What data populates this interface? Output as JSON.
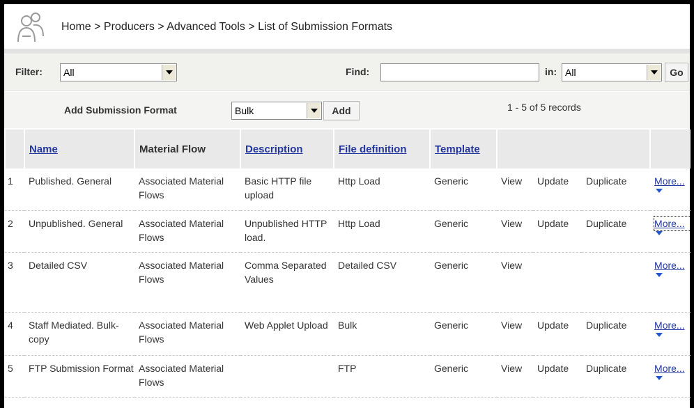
{
  "breadcrumb": "Home > Producers > Advanced Tools > List of Submission Formats",
  "filter": {
    "label": "Filter:",
    "value": "All"
  },
  "find": {
    "label": "Find:",
    "value": ""
  },
  "in": {
    "label": "in:",
    "value": "All"
  },
  "go_label": "Go",
  "add": {
    "label": "Add Submission Format",
    "value": "Bulk",
    "button": "Add"
  },
  "records": "1 - 5 of 5 records",
  "columns": {
    "name": "Name",
    "material_flow": "Material Flow",
    "description": "Description",
    "file_definition": "File definition",
    "template": "Template"
  },
  "actions": {
    "view": "View",
    "update": "Update",
    "duplicate": "Duplicate",
    "more": "More..."
  },
  "rows": [
    {
      "num": "1",
      "name": "Published. General",
      "material_flow": "Associated Material Flows",
      "description": "Basic HTTP file upload",
      "file_definition": "Http Load",
      "template": "Generic"
    },
    {
      "num": "2",
      "name": "Unpublished. General",
      "material_flow": "Associated Material Flows",
      "description": "Unpublished HTTP load.",
      "file_definition": "Http Load",
      "template": "Generic"
    },
    {
      "num": "3",
      "name": "Detailed CSV",
      "material_flow": "Associated Material Flows",
      "description": "Comma Separated Values",
      "file_definition": "Detailed CSV",
      "template": "Generic"
    },
    {
      "num": "4",
      "name": "Staff Mediated. Bulk-copy",
      "material_flow": "Associated Material Flows",
      "description": "Web Applet Upload",
      "file_definition": "Bulk",
      "template": "Generic"
    },
    {
      "num": "5",
      "name": "FTP Submission Format",
      "material_flow": "Associated Material Flows",
      "description": "",
      "file_definition": "FTP",
      "template": "Generic"
    }
  ],
  "icons": {
    "logo": "users-icon",
    "dropdown": "chevron-down-icon"
  }
}
